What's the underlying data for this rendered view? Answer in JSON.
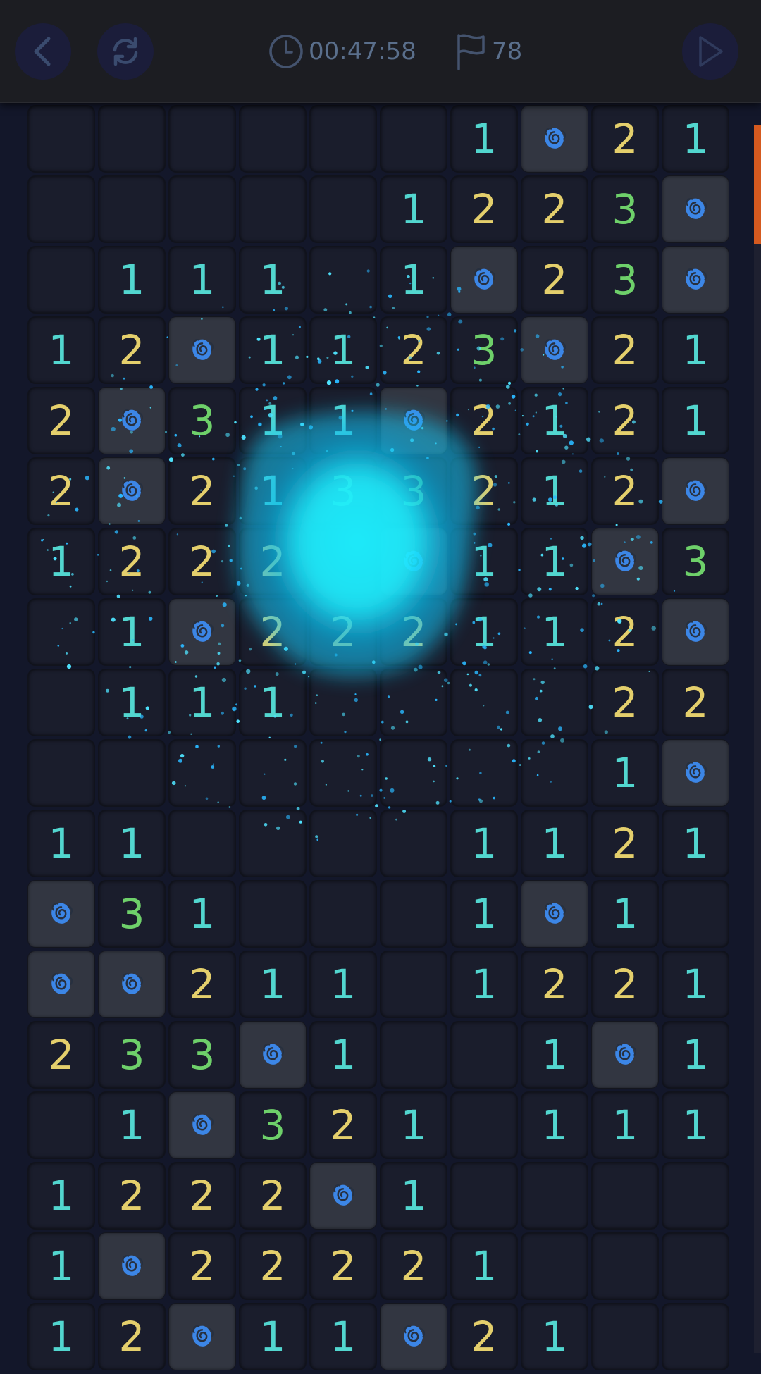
{
  "header": {
    "timer": "00:47:58",
    "flags": "78",
    "icons": {
      "back": "chevron-left-icon",
      "restart": "refresh-icon",
      "timer": "clock-icon",
      "flags": "flag-icon",
      "play": "play-icon"
    }
  },
  "board": {
    "columns": 10,
    "mine_icon": "rose-icon",
    "colors": {
      "1": "#52d6cf",
      "2": "#e4cf6c",
      "3": "#6ed06a",
      "mine_glyph": "#3c86e6",
      "explosion": "#1ff0ff"
    },
    "rows": [
      [
        "",
        "",
        "",
        "",
        "",
        "",
        "1",
        "M",
        "2",
        "1"
      ],
      [
        "",
        "",
        "",
        "",
        "",
        "1",
        "2",
        "2",
        "3",
        "M"
      ],
      [
        "",
        "1",
        "1",
        "1",
        "",
        "1",
        "M",
        "2",
        "3",
        "M"
      ],
      [
        "1",
        "2",
        "M",
        "1",
        "1",
        "2",
        "3",
        "M",
        "2",
        "1"
      ],
      [
        "2",
        "M",
        "3",
        "1",
        "1",
        "M",
        "2",
        "1",
        "2",
        "1"
      ],
      [
        "2",
        "M",
        "2",
        "1",
        "3",
        "3",
        "2",
        "1",
        "2",
        "M"
      ],
      [
        "1",
        "2",
        "2",
        "2",
        "",
        "M",
        "1",
        "1",
        "M",
        "3"
      ],
      [
        "",
        "1",
        "M",
        "2",
        "2",
        "2",
        "1",
        "1",
        "2",
        "M"
      ],
      [
        "",
        "1",
        "1",
        "1",
        "",
        "",
        "",
        "",
        "2",
        "2"
      ],
      [
        "",
        "",
        "",
        "",
        "",
        "",
        "",
        "",
        "1",
        "M"
      ],
      [
        "1",
        "1",
        "",
        "",
        "",
        "",
        "1",
        "1",
        "2",
        "1"
      ],
      [
        "M",
        "3",
        "1",
        "",
        "",
        "",
        "1",
        "M",
        "1",
        ""
      ],
      [
        "M",
        "M",
        "2",
        "1",
        "1",
        "",
        "1",
        "2",
        "2",
        "1"
      ],
      [
        "2",
        "3",
        "3",
        "M",
        "1",
        "",
        "",
        "1",
        "M",
        "1"
      ],
      [
        "",
        "1",
        "M",
        "3",
        "2",
        "1",
        "",
        "1",
        "1",
        "1"
      ],
      [
        "1",
        "2",
        "2",
        "2",
        "M",
        "1",
        "",
        "",
        "",
        ""
      ],
      [
        "1",
        "M",
        "2",
        "2",
        "2",
        "2",
        "1",
        "",
        "",
        ""
      ],
      [
        "1",
        "2",
        "M",
        "1",
        "1",
        "M",
        "2",
        "1",
        "",
        ""
      ]
    ]
  }
}
